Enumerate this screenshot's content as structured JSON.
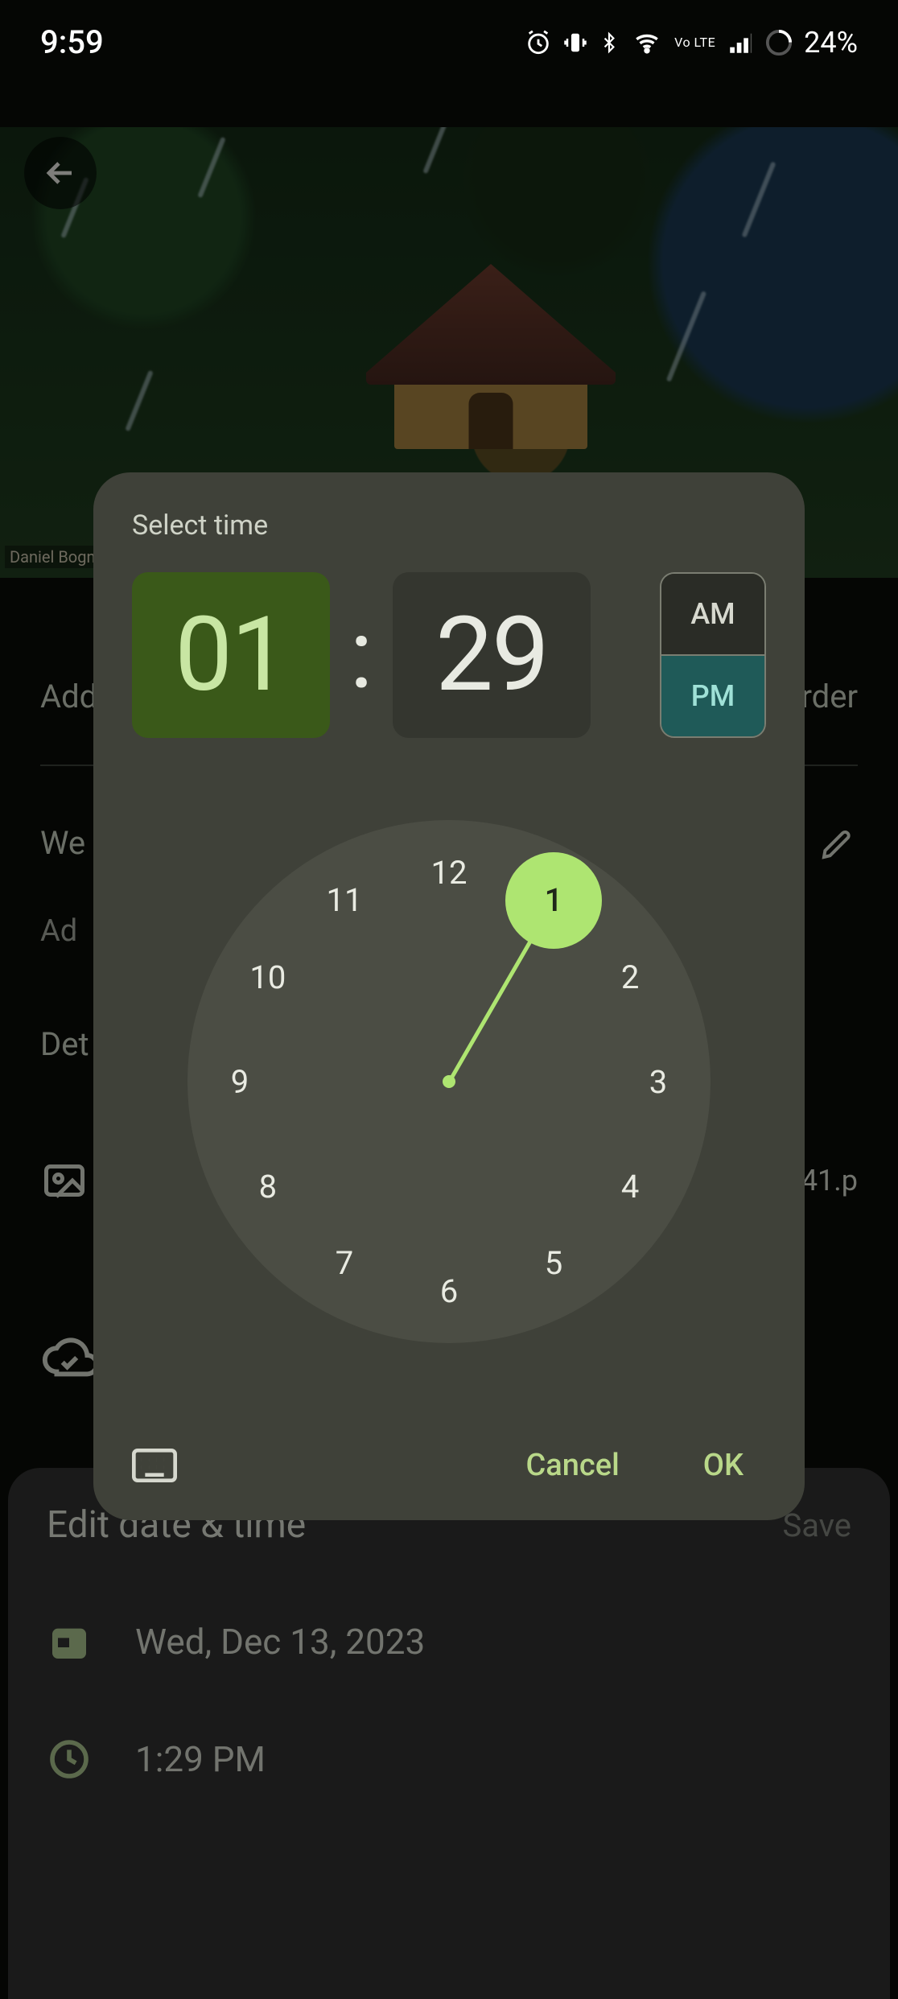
{
  "status": {
    "time": "9:59",
    "battery_pct": "24%",
    "volte_label": "Vo LTE"
  },
  "image": {
    "artist_credit": "Daniel Bogni"
  },
  "background": {
    "add_label": "Add",
    "order_label": "Order",
    "wed_partial": "We",
    "add_partial": "Ad",
    "det_partial": "Det",
    "filename_partial": "41.p"
  },
  "bottom_sheet": {
    "title": "Edit date & time",
    "save_label": "Save",
    "date_text": "Wed, Dec 13, 2023",
    "time_text": "1:29 PM"
  },
  "dialog": {
    "title": "Select time",
    "hour": "01",
    "minute": "29",
    "colon": ":",
    "am_label": "AM",
    "pm_label": "PM",
    "selected_hour": 1,
    "hours": [
      "12",
      "1",
      "2",
      "3",
      "4",
      "5",
      "6",
      "7",
      "8",
      "9",
      "10",
      "11"
    ],
    "cancel_label": "Cancel",
    "ok_label": "OK"
  }
}
